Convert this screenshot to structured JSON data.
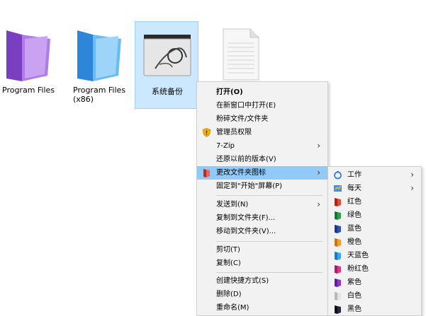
{
  "desktop": {
    "icons": [
      {
        "label": "Program Files",
        "icon": "purple-folder-icon"
      },
      {
        "label": "Program Files\n(x86)",
        "icon": "blue-folder-icon"
      },
      {
        "label": "系统备份",
        "icon": "decorated-folder-icon"
      },
      {
        "label": "",
        "icon": "document-icon"
      }
    ]
  },
  "context_menu": {
    "items": [
      {
        "label": "打开(O)"
      },
      {
        "label": "在新窗口中打开(E)"
      },
      {
        "label": "粉碎文件/文件夹"
      },
      {
        "label": "管理员权限",
        "icon": "shield-icon"
      },
      {
        "label": "7-Zip",
        "submenu": true
      },
      {
        "label": "还原以前的版本(V)"
      },
      {
        "label": "更改文件夹图标",
        "icon": "red-folder-icon",
        "submenu": true
      },
      {
        "label": "固定到\"开始\"屏幕(P)"
      },
      {
        "label": "发送到(N)",
        "submenu": true
      },
      {
        "label": "复制到文件夹(F)..."
      },
      {
        "label": "移动到文件夹(V)..."
      },
      {
        "label": "剪切(T)"
      },
      {
        "label": "复制(C)"
      },
      {
        "label": "创建快捷方式(S)"
      },
      {
        "label": "删除(D)"
      },
      {
        "label": "重命名(M)"
      }
    ]
  },
  "folder_icon_submenu": {
    "items": [
      {
        "label": "工作",
        "color": "#3b7fd6",
        "submenu": true
      },
      {
        "label": "每天",
        "color": "#4a8ee0",
        "submenu": true
      },
      {
        "label": "红色",
        "color": "#e04a3a"
      },
      {
        "label": "绿色",
        "color": "#2e9e4a"
      },
      {
        "label": "蓝色",
        "color": "#2e56b0"
      },
      {
        "label": "橙色",
        "color": "#f0a030"
      },
      {
        "label": "天蓝色",
        "color": "#3aa8e8"
      },
      {
        "label": "粉红色",
        "color": "#d63a8a"
      },
      {
        "label": "紫色",
        "color": "#8e3ac8"
      },
      {
        "label": "白色",
        "color": "#e4e4e4"
      },
      {
        "label": "黑色",
        "color": "#2a2a3a"
      }
    ]
  }
}
